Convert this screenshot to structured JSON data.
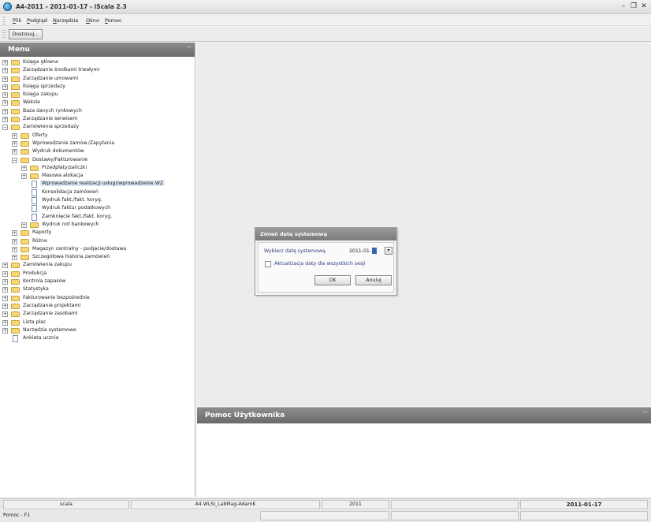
{
  "window": {
    "title": "A4-2011 - 2011-01-17 - iScala 2.3"
  },
  "menubar": [
    "Plik",
    "Podgląd",
    "Narzędzia",
    "Okno",
    "Pomoc"
  ],
  "toolbar": {
    "customize_label": "Dostosuj..."
  },
  "left_panel": {
    "title": "Menu"
  },
  "tree": [
    {
      "label": "Księga główna",
      "level": 0,
      "kind": "folder",
      "state": "collapsed"
    },
    {
      "label": "Zarządzanie środkami trwałymi",
      "level": 0,
      "kind": "folder",
      "state": "collapsed"
    },
    {
      "label": "Zarządzanie umowami",
      "level": 0,
      "kind": "folder",
      "state": "collapsed"
    },
    {
      "label": "Księga sprzedaży",
      "level": 0,
      "kind": "folder",
      "state": "collapsed"
    },
    {
      "label": "Księga zakupu",
      "level": 0,
      "kind": "folder",
      "state": "collapsed"
    },
    {
      "label": "Weksle",
      "level": 0,
      "kind": "folder",
      "state": "collapsed"
    },
    {
      "label": "Baza danych rynkowych",
      "level": 0,
      "kind": "folder",
      "state": "collapsed"
    },
    {
      "label": "Zarządzanie serwisem",
      "level": 0,
      "kind": "folder",
      "state": "collapsed"
    },
    {
      "label": "Zamówienia sprzedaży",
      "level": 0,
      "kind": "folder",
      "state": "expanded"
    },
    {
      "label": "Oferty",
      "level": 1,
      "kind": "folder",
      "state": "collapsed"
    },
    {
      "label": "Wprowadzanie zamów./Zapytania",
      "level": 1,
      "kind": "folder",
      "state": "collapsed"
    },
    {
      "label": "Wydruk dokumentów",
      "level": 1,
      "kind": "folder",
      "state": "collapsed"
    },
    {
      "label": "Dostawy/Fakturowanie",
      "level": 1,
      "kind": "folder",
      "state": "expanded"
    },
    {
      "label": "Przedpłaty/zaliczki",
      "level": 2,
      "kind": "folder",
      "state": "collapsed"
    },
    {
      "label": "Masowa alokacja",
      "level": 2,
      "kind": "folder",
      "state": "collapsed"
    },
    {
      "label": "Wprowadzanie realizacji usługi/wprowadzenie WZ",
      "level": 2,
      "kind": "doc",
      "selected": true
    },
    {
      "label": "Konsolidacja zamówień",
      "level": 2,
      "kind": "doc"
    },
    {
      "label": "Wydruk fakt./fakt. koryg.",
      "level": 2,
      "kind": "doc"
    },
    {
      "label": "Wydruk faktur podatkowych",
      "level": 2,
      "kind": "doc"
    },
    {
      "label": "Zamknięcie fakt./fakt. koryg.",
      "level": 2,
      "kind": "doc"
    },
    {
      "label": "Wydruk not bankowych",
      "level": 2,
      "kind": "folder",
      "state": "collapsed"
    },
    {
      "label": "Raporty",
      "level": 1,
      "kind": "folder",
      "state": "collapsed"
    },
    {
      "label": "Różne",
      "level": 1,
      "kind": "folder",
      "state": "collapsed"
    },
    {
      "label": "Magazyn centralny - podjęcie/dostawa",
      "level": 1,
      "kind": "folder",
      "state": "collapsed"
    },
    {
      "label": "Szczegółowa historia zamówień",
      "level": 1,
      "kind": "folder",
      "state": "collapsed"
    },
    {
      "label": "Zamówienia zakupu",
      "level": 0,
      "kind": "folder",
      "state": "collapsed"
    },
    {
      "label": "Produkcja",
      "level": 0,
      "kind": "folder",
      "state": "collapsed"
    },
    {
      "label": "Kontrola zapasów",
      "level": 0,
      "kind": "folder",
      "state": "collapsed"
    },
    {
      "label": "Statystyka",
      "level": 0,
      "kind": "folder",
      "state": "collapsed"
    },
    {
      "label": "Fakturowanie bezpośrednie",
      "level": 0,
      "kind": "folder",
      "state": "collapsed"
    },
    {
      "label": "Zarządzanie projektami",
      "level": 0,
      "kind": "folder",
      "state": "collapsed"
    },
    {
      "label": "Zarządzanie zasobami",
      "level": 0,
      "kind": "folder",
      "state": "collapsed"
    },
    {
      "label": "Lista płac",
      "level": 0,
      "kind": "folder",
      "state": "collapsed"
    },
    {
      "label": "Narzędzia systemowe",
      "level": 0,
      "kind": "folder",
      "state": "collapsed"
    },
    {
      "label": "Ankieta ucznia",
      "level": 0,
      "kind": "doc"
    }
  ],
  "dialog": {
    "title": "Zmień datę systemową",
    "date_label": "Wybierz datę systemową",
    "date_value": "2011-01-",
    "checkbox_label": "Aktualizacja daty dla wszystkich sesji",
    "ok_label": "OK",
    "cancel_label": "Anuluj"
  },
  "help_panel": {
    "title": "Pomoc Użytkownika"
  },
  "status": {
    "row1": [
      "scala",
      "A4 WLSI_LabMag-AdamK",
      "2011",
      "",
      "2011-01-17"
    ],
    "row2": [
      "Pomoc - F1"
    ]
  },
  "colors": {
    "header": "#7a7a7a",
    "label_blue": "#2b3a84",
    "folder": "#f6d773"
  }
}
